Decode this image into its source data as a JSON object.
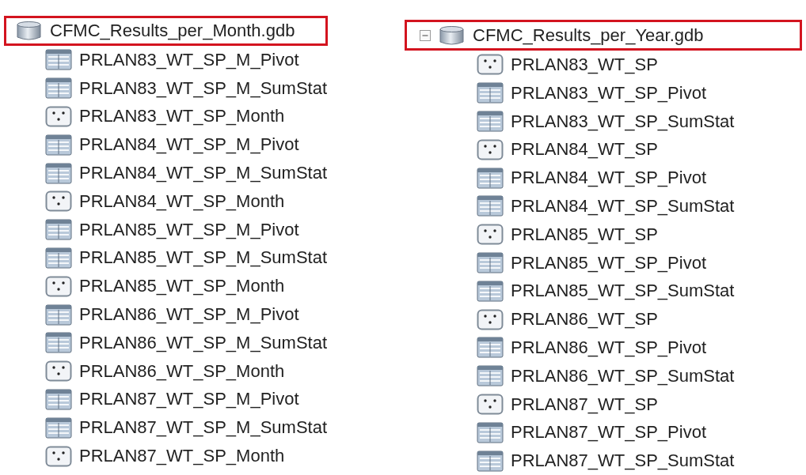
{
  "trees": [
    {
      "name": "CFMC_Results_per_Month.gdb",
      "highlighted": true,
      "items": [
        {
          "kind": "table",
          "label": "PRLAN83_WT_SP_M_Pivot"
        },
        {
          "kind": "table",
          "label": "PRLAN83_WT_SP_M_SumStat"
        },
        {
          "kind": "points",
          "label": "PRLAN83_WT_SP_Month"
        },
        {
          "kind": "table",
          "label": "PRLAN84_WT_SP_M_Pivot"
        },
        {
          "kind": "table",
          "label": "PRLAN84_WT_SP_M_SumStat"
        },
        {
          "kind": "points",
          "label": "PRLAN84_WT_SP_Month"
        },
        {
          "kind": "table",
          "label": "PRLAN85_WT_SP_M_Pivot"
        },
        {
          "kind": "table",
          "label": "PRLAN85_WT_SP_M_SumStat"
        },
        {
          "kind": "points",
          "label": "PRLAN85_WT_SP_Month"
        },
        {
          "kind": "table",
          "label": "PRLAN86_WT_SP_M_Pivot"
        },
        {
          "kind": "table",
          "label": "PRLAN86_WT_SP_M_SumStat"
        },
        {
          "kind": "points",
          "label": "PRLAN86_WT_SP_Month"
        },
        {
          "kind": "table",
          "label": "PRLAN87_WT_SP_M_Pivot"
        },
        {
          "kind": "table",
          "label": "PRLAN87_WT_SP_M_SumStat"
        },
        {
          "kind": "points",
          "label": "PRLAN87_WT_SP_Month"
        }
      ]
    },
    {
      "name": "CFMC_Results_per_Year.gdb",
      "highlighted": true,
      "expanded": true,
      "items": [
        {
          "kind": "points",
          "label": "PRLAN83_WT_SP"
        },
        {
          "kind": "table",
          "label": "PRLAN83_WT_SP_Pivot"
        },
        {
          "kind": "table",
          "label": "PRLAN83_WT_SP_SumStat"
        },
        {
          "kind": "points",
          "label": "PRLAN84_WT_SP"
        },
        {
          "kind": "table",
          "label": "PRLAN84_WT_SP_Pivot"
        },
        {
          "kind": "table",
          "label": "PRLAN84_WT_SP_SumStat"
        },
        {
          "kind": "points",
          "label": "PRLAN85_WT_SP"
        },
        {
          "kind": "table",
          "label": "PRLAN85_WT_SP_Pivot"
        },
        {
          "kind": "table",
          "label": "PRLAN85_WT_SP_SumStat"
        },
        {
          "kind": "points",
          "label": "PRLAN86_WT_SP"
        },
        {
          "kind": "table",
          "label": "PRLAN86_WT_SP_Pivot"
        },
        {
          "kind": "table",
          "label": "PRLAN86_WT_SP_SumStat"
        },
        {
          "kind": "points",
          "label": "PRLAN87_WT_SP"
        },
        {
          "kind": "table",
          "label": "PRLAN87_WT_SP_Pivot"
        },
        {
          "kind": "table",
          "label": "PRLAN87_WT_SP_SumStat"
        }
      ]
    }
  ]
}
